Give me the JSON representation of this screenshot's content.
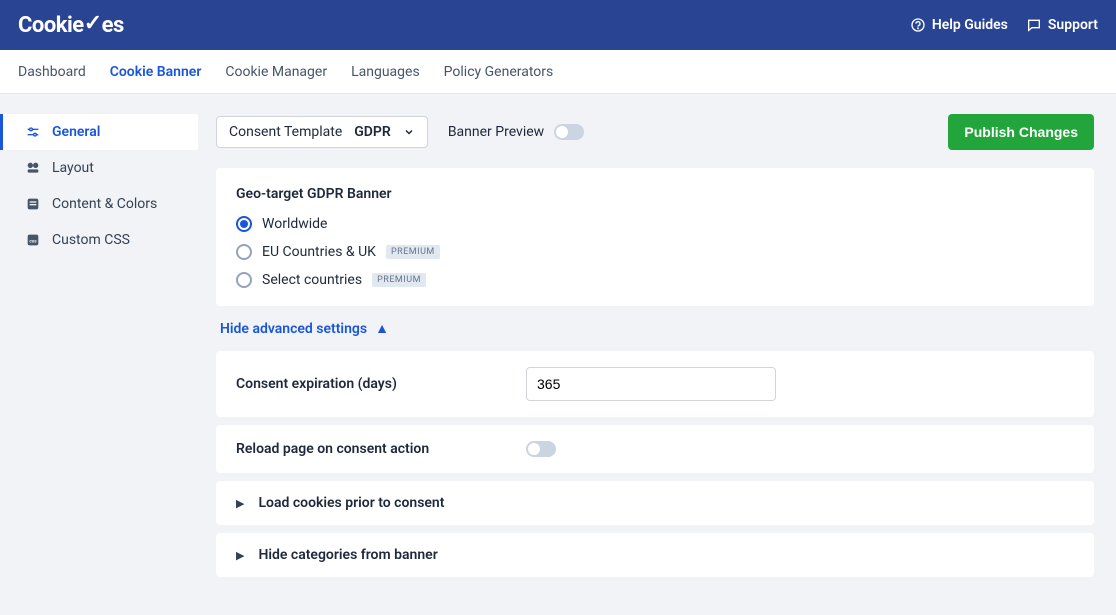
{
  "brand": "CookieYes",
  "topbar": {
    "help_label": "Help Guides",
    "support_label": "Support"
  },
  "nav": {
    "items": [
      {
        "label": "Dashboard"
      },
      {
        "label": "Cookie Banner"
      },
      {
        "label": "Cookie Manager"
      },
      {
        "label": "Languages"
      },
      {
        "label": "Policy Generators"
      }
    ],
    "active_index": 1
  },
  "sidebar": {
    "items": [
      {
        "label": "General",
        "icon": "sliders-icon"
      },
      {
        "label": "Layout",
        "icon": "layout-icon"
      },
      {
        "label": "Content & Colors",
        "icon": "content-icon"
      },
      {
        "label": "Custom CSS",
        "icon": "css-icon"
      }
    ],
    "active_index": 0
  },
  "toolbar": {
    "template_label": "Consent Template",
    "template_value": "GDPR",
    "preview_label": "Banner Preview",
    "publish_label": "Publish Changes"
  },
  "geo": {
    "title": "Geo-target GDPR Banner",
    "options": [
      {
        "label": "Worldwide",
        "checked": true
      },
      {
        "label": "EU Countries & UK",
        "checked": false,
        "premium": true
      },
      {
        "label": "Select countries",
        "checked": false,
        "premium": true
      }
    ],
    "premium_badge": "PREMIUM"
  },
  "advanced": {
    "toggle_label": "Hide advanced settings",
    "consent_expiration_label": "Consent expiration (days)",
    "consent_expiration_value": "365",
    "reload_label": "Reload page on consent action",
    "load_cookies_label": "Load cookies prior to consent",
    "hide_categories_label": "Hide categories from banner"
  }
}
